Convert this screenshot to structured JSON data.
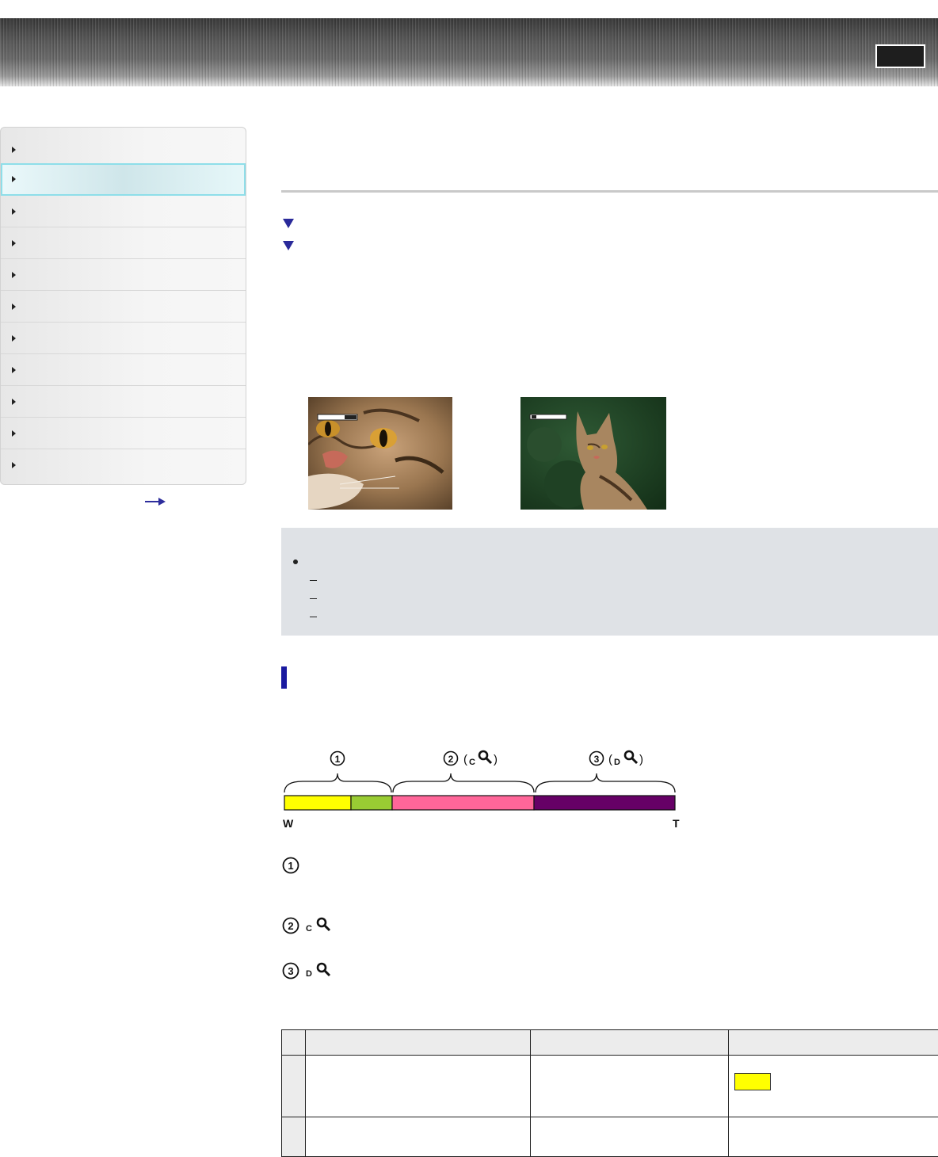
{
  "header": {
    "button_label": ""
  },
  "sidebar": {
    "items": [
      {
        "label": ""
      },
      {
        "label": "",
        "active": true
      },
      {
        "label": ""
      },
      {
        "label": ""
      },
      {
        "label": ""
      },
      {
        "label": ""
      },
      {
        "label": ""
      },
      {
        "label": ""
      },
      {
        "label": ""
      },
      {
        "label": ""
      },
      {
        "label": ""
      }
    ],
    "more_icon": "arrow-right-icon"
  },
  "main": {
    "anchor_links": [
      {
        "icon": "triangle-down-icon",
        "label": ""
      },
      {
        "icon": "triangle-down-icon",
        "label": ""
      }
    ],
    "photos": [
      {
        "name": "cat-closeup-photo",
        "zoom_indicator": "zoom-bar-tele"
      },
      {
        "name": "cat-wide-photo",
        "zoom_indicator": "zoom-bar-wide"
      }
    ],
    "note": {
      "bullet_icon": "bullet-icon",
      "dash_items": 3
    },
    "zoom_diagram": {
      "labels": {
        "group1": "①",
        "group2": "②",
        "group2_letter": "C",
        "group3": "③",
        "group3_letter": "D",
        "wide_end": "W",
        "tele_end": "T"
      },
      "segment_colors": [
        "#ffff00",
        "#99cc33",
        "#ff6699",
        "#660066"
      ],
      "icons": [
        "magnifier-icon"
      ]
    },
    "legend": [
      {
        "number": "①",
        "letter": ""
      },
      {
        "number": "②",
        "letter": "C"
      },
      {
        "number": "③",
        "letter": "D"
      }
    ],
    "table": {
      "headers": [
        "",
        "",
        "",
        ""
      ],
      "rows": [
        {
          "cells": [
            "",
            "",
            "",
            ""
          ],
          "swatch_color": "#ffff00"
        },
        {
          "cells": [
            "",
            "",
            "",
            ""
          ]
        }
      ]
    }
  }
}
